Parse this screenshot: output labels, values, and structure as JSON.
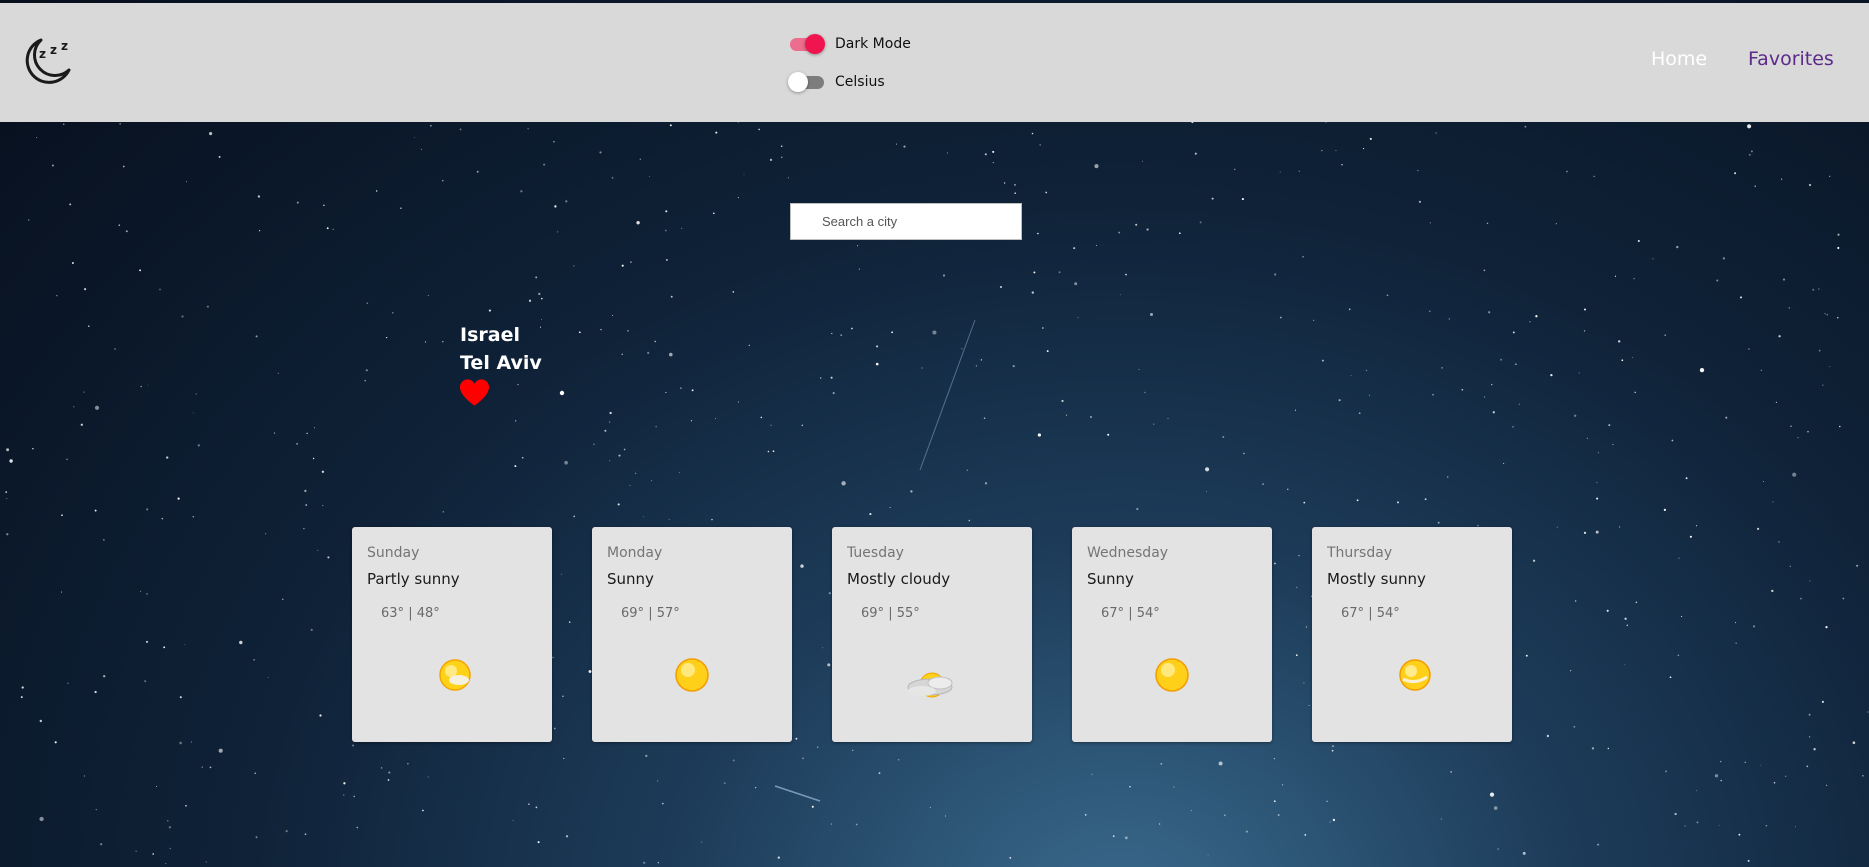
{
  "header": {
    "logo_icon": "sleep-moon-icon",
    "dark_mode": {
      "label": "Dark Mode",
      "enabled": true
    },
    "celsius": {
      "label": "Celsius",
      "enabled": false
    },
    "nav": {
      "home": "Home",
      "favorites": "Favorites"
    }
  },
  "search": {
    "placeholder": "Search a city",
    "value": ""
  },
  "location": {
    "country": "Israel",
    "city": "Tel Aviv",
    "favorite_icon": "heart-icon",
    "is_favorite": true
  },
  "forecast": [
    {
      "day": "Sunday",
      "condition": "Partly sunny",
      "high": "63°",
      "low": "48°",
      "icon": "partly-sunny-icon"
    },
    {
      "day": "Monday",
      "condition": "Sunny",
      "high": "69°",
      "low": "57°",
      "icon": "sunny-icon"
    },
    {
      "day": "Tuesday",
      "condition": "Mostly cloudy",
      "high": "69°",
      "low": "55°",
      "icon": "mostly-cloudy-icon"
    },
    {
      "day": "Wednesday",
      "condition": "Sunny",
      "high": "67°",
      "low": "54°",
      "icon": "sunny-icon"
    },
    {
      "day": "Thursday",
      "condition": "Mostly sunny",
      "high": "67°",
      "low": "54°",
      "icon": "mostly-sunny-icon"
    }
  ],
  "colors": {
    "navbar_bg": "#d9d9d9",
    "toggle_on": "#f0154f",
    "favorites_link": "#5b2a8a",
    "heart": "#ff0000",
    "card_bg": "#e3e3e3"
  }
}
